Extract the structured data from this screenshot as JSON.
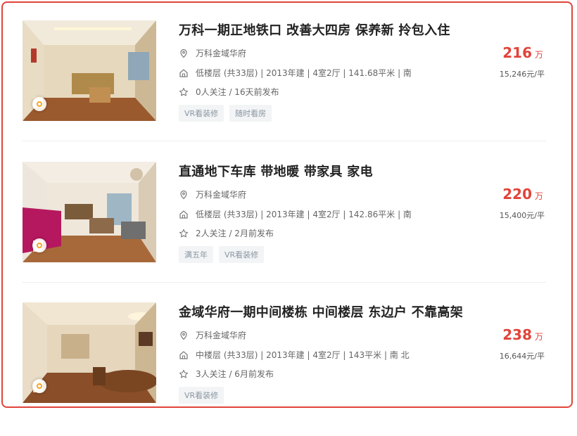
{
  "listings": [
    {
      "title": "万科一期正地铁口 改善大四房 保养新 拎包入住",
      "community": "万科金域华府",
      "info": "低楼层 (共33层) | 2013年建 | 4室2厅 | 141.68平米 | 南",
      "follow": "0人关注 / 16天前发布",
      "tags": [
        "VR看装修",
        "随时看房"
      ],
      "price": "216",
      "price_unit": "万",
      "unit_price": "15,246元/平"
    },
    {
      "title": "直通地下车库 带地暖 带家具 家电",
      "community": "万科金域华府",
      "info": "低楼层 (共33层) | 2013年建 | 4室2厅 | 142.86平米 | 南",
      "follow": "2人关注 / 2月前发布",
      "tags": [
        "满五年",
        "VR看装修"
      ],
      "price": "220",
      "price_unit": "万",
      "unit_price": "15,400元/平"
    },
    {
      "title": "金域华府一期中间楼栋 中间楼层 东边户 不靠高架",
      "community": "万科金域华府",
      "info": "中楼层 (共33层) | 2013年建 | 4室2厅 | 143平米 | 南 北",
      "follow": "3人关注 / 6月前发布",
      "tags": [
        "VR看装修"
      ],
      "price": "238",
      "price_unit": "万",
      "unit_price": "16,644元/平"
    }
  ],
  "colors": {
    "accent": "#e0443a",
    "tag_bg": "#f2f4f5",
    "tag_text": "#8a96a2"
  },
  "icons": {
    "location": "location-pin-icon",
    "house": "house-icon",
    "follow": "star-icon"
  }
}
